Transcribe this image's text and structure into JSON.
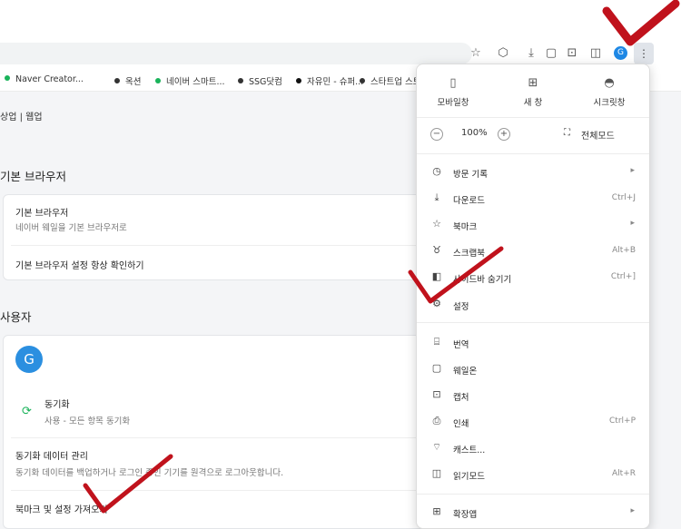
{
  "bookmarks": [
    {
      "label": "Naver Creator...",
      "color": "#19b35a"
    },
    {
      "label": "옥션",
      "color": "#333333"
    },
    {
      "label": "네이버 스마트...",
      "color": "#19b35a"
    },
    {
      "label": "SSG닷컴",
      "color": "#333333"
    },
    {
      "label": "자유민 - 슈퍼...",
      "color": "#111111"
    },
    {
      "label": "스타트업 스토",
      "color": "#333333"
    }
  ],
  "toolbar": {
    "avatar_letter": "G"
  },
  "page": {
    "tabs": "상업 | 웹업",
    "default_browser": {
      "section_title": "기본 브라우저",
      "item_title": "기본 브라우저",
      "item_desc": "네이버 웨일을 기본 브라우저로",
      "check_label": "기본 브라우저 설정 항상 확인하기"
    },
    "user": {
      "section_title": "사용자",
      "avatar_letter": "G",
      "sync_title": "동기화",
      "sync_desc": "사용 - 모든 항목 동기화",
      "manage_title": "동기화 데이터 관리",
      "manage_desc": "동기화 데이터를 백업하거나 로그인 중인 기기를 원격으로 로그아웃합니다.",
      "import_label": "북마크 및 설정 가져오기"
    }
  },
  "menu": {
    "quick": [
      {
        "label": "모바일창",
        "icon": "mobile-icon"
      },
      {
        "label": "새 창",
        "icon": "new-window-icon"
      },
      {
        "label": "시크릿창",
        "icon": "secret-icon"
      }
    ],
    "zoom": {
      "minus": "−",
      "value": "100%",
      "plus": "+",
      "fullscreen": "전체모드"
    },
    "items": [
      {
        "label": "방문 기록",
        "icon": "history-icon",
        "shortcut": "",
        "submenu": true
      },
      {
        "label": "다운로드",
        "icon": "download-icon",
        "shortcut": "Ctrl+J",
        "submenu": false
      },
      {
        "label": "북마크",
        "icon": "bookmark-star-icon",
        "shortcut": "",
        "submenu": true
      },
      {
        "label": "스크랩북",
        "icon": "scrapbook-icon",
        "shortcut": "Alt+B",
        "submenu": false
      },
      {
        "label": "사이드바 숨기기",
        "icon": "sidebar-icon",
        "shortcut": "Ctrl+]",
        "submenu": false
      },
      {
        "label": "설정",
        "icon": "gear-icon",
        "shortcut": "",
        "submenu": false
      },
      {
        "label": "번역",
        "icon": "translate-icon",
        "shortcut": "",
        "submenu": false
      },
      {
        "label": "웨일온",
        "icon": "whaleon-icon",
        "shortcut": "",
        "submenu": false
      },
      {
        "label": "캡처",
        "icon": "capture-icon",
        "shortcut": "",
        "submenu": false
      },
      {
        "label": "인쇄",
        "icon": "print-icon",
        "shortcut": "Ctrl+P",
        "submenu": false
      },
      {
        "label": "캐스트...",
        "icon": "cast-icon",
        "shortcut": "",
        "submenu": false
      },
      {
        "label": "읽기모드",
        "icon": "reading-mode-icon",
        "shortcut": "Alt+R",
        "submenu": false
      },
      {
        "label": "확장앱",
        "icon": "extensions-icon",
        "shortcut": "",
        "submenu": true
      }
    ]
  },
  "colors": {
    "check_mark": "#c0121c",
    "accent_blue": "#2b8fe0",
    "sync_green": "#19b35a"
  }
}
